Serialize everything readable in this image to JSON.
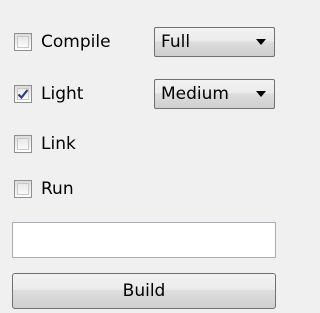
{
  "options": [
    {
      "label": "Compile",
      "checked": false
    },
    {
      "label": "Light",
      "checked": true
    },
    {
      "label": "Link",
      "checked": false
    },
    {
      "label": "Run",
      "checked": false
    }
  ],
  "compile_mode": {
    "selected": "Full"
  },
  "light_level": {
    "selected": "Medium"
  },
  "input": {
    "value": "",
    "placeholder": ""
  },
  "build_button": {
    "label": "Build"
  }
}
